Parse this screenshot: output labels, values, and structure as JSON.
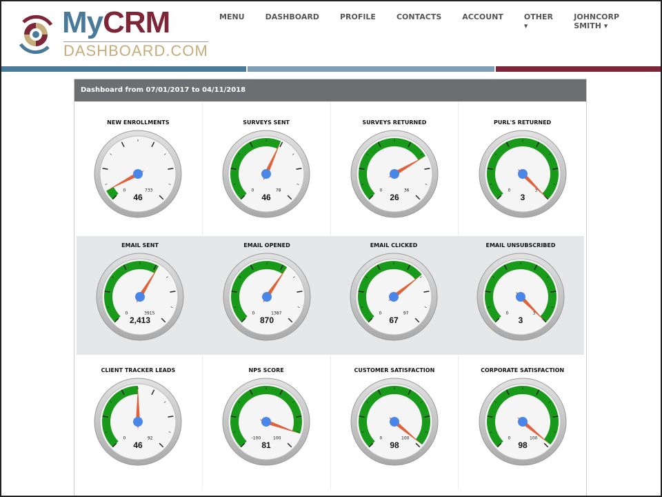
{
  "logo": {
    "my": "My",
    "crm": "CRM",
    "sub": "DASHBOARD.COM"
  },
  "nav": [
    "MENU",
    "DASHBOARD",
    "PROFILE",
    "CONTACTS",
    "ACCOUNT",
    "OTHER ▾",
    "JOHNCORP SMITH ▾"
  ],
  "colors": {
    "blue": "#4a7a99",
    "light_blue": "#7f9fb7",
    "maroon": "#7d2637",
    "gold": "#c3ad7b",
    "green": "#1a9a1a",
    "needle": "#e0623a",
    "hub": "#4a86e8"
  },
  "panel_title": "Dashboard from 07/01/2017 to 04/11/2018",
  "rows": [
    [
      {
        "title": "NEW ENROLLMENTS",
        "min": 0,
        "max": 733,
        "value": 46,
        "display": "46"
      },
      {
        "title": "SURVEYS SENT",
        "min": 0,
        "max": 78,
        "value": 46,
        "display": "46"
      },
      {
        "title": "SURVEYS RETURNED",
        "min": 0,
        "max": 36,
        "value": 26,
        "display": "26"
      },
      {
        "title": "PURL'S RETURNED",
        "min": 0,
        "max": 3,
        "value": 3,
        "display": "3"
      }
    ],
    [
      {
        "title": "EMAIL SENT",
        "min": 0,
        "max": 3915,
        "value": 2413,
        "display": "2,413"
      },
      {
        "title": "EMAIL OPENED",
        "min": 0,
        "max": 1387,
        "value": 870,
        "display": "870"
      },
      {
        "title": "EMAIL CLICKED",
        "min": 0,
        "max": 97,
        "value": 67,
        "display": "67"
      },
      {
        "title": "EMAIL UNSUBSCRIBED",
        "min": 0,
        "max": 3,
        "value": 3,
        "display": "3"
      }
    ],
    [
      {
        "title": "CLIENT TRACKER LEADS",
        "min": 0,
        "max": 92,
        "value": 46,
        "display": "46"
      },
      {
        "title": "NPS SCORE",
        "min": -100,
        "max": 100,
        "value": 81,
        "display": "81"
      },
      {
        "title": "CUSTOMER SATISFACTION",
        "min": 0,
        "max": 100,
        "value": 98,
        "display": "98"
      },
      {
        "title": "CORPORATE SATISFACTION",
        "min": 0,
        "max": 100,
        "value": 98,
        "display": "98"
      }
    ]
  ]
}
